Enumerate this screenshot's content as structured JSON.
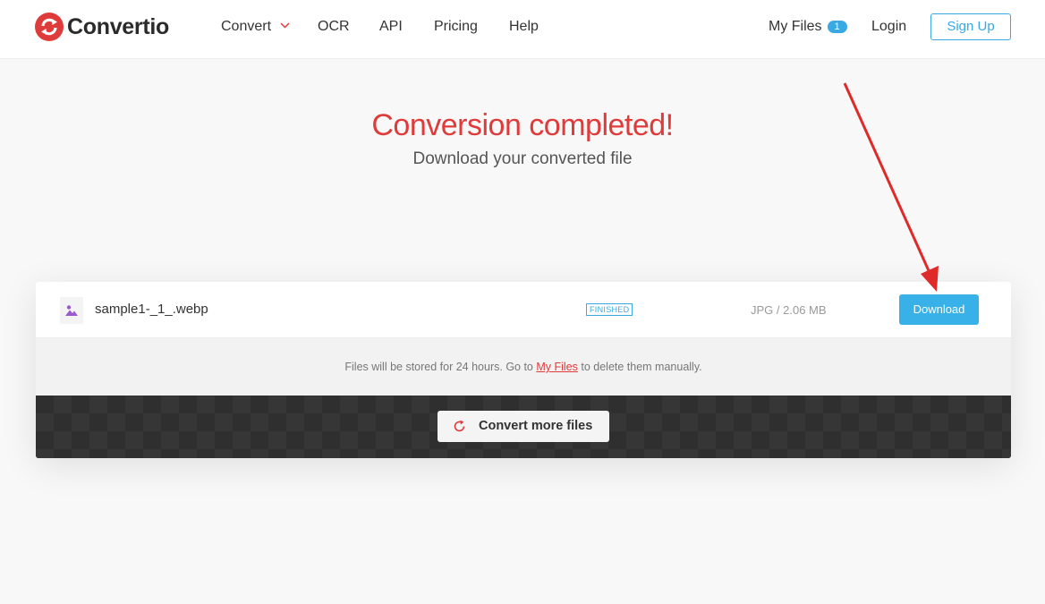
{
  "header": {
    "brand": "Convertio",
    "nav": {
      "convert": "Convert",
      "ocr": "OCR",
      "api": "API",
      "pricing": "Pricing",
      "help": "Help"
    },
    "my_files": "My Files",
    "my_files_count": "1",
    "login": "Login",
    "signup": "Sign Up"
  },
  "hero": {
    "title": "Conversion completed!",
    "subtitle": "Download your converted file"
  },
  "file": {
    "name": "sample1-_1_.webp",
    "status": "FINISHED",
    "meta": "JPG / 2.06 MB",
    "download_label": "Download",
    "icon": "image-file-icon"
  },
  "notice": {
    "before": "Files will be stored for 24 hours. Go to ",
    "link": "My Files",
    "after": " to delete them manually."
  },
  "actions": {
    "convert_more": "Convert more files"
  },
  "colors": {
    "brand_red": "#e03b3b",
    "accent_blue": "#38a9e3",
    "annotation_arrow": "#e02a2a"
  }
}
